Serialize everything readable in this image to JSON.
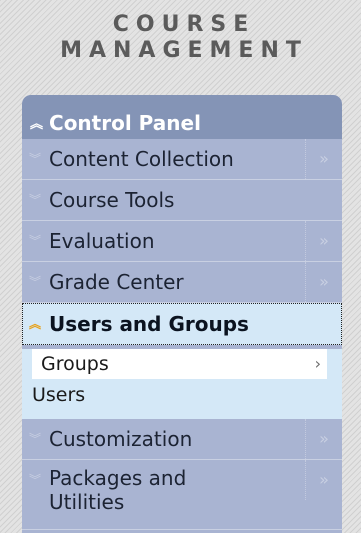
{
  "header": {
    "line1": "COURSE",
    "line2": "MANAGEMENT"
  },
  "panel": {
    "title": "Control Panel",
    "items": [
      {
        "label": "Content Collection",
        "has_more": true,
        "more": "»"
      },
      {
        "label": "Course Tools",
        "has_more": false,
        "more": ""
      },
      {
        "label": "Evaluation",
        "has_more": true,
        "more": "»"
      },
      {
        "label": "Grade Center",
        "has_more": true,
        "more": "»"
      }
    ],
    "active": {
      "label": "Users and Groups",
      "sub_items": [
        {
          "label": "Groups",
          "selected": true,
          "arrow": "›"
        },
        {
          "label": "Users",
          "selected": false
        }
      ]
    },
    "items_after": [
      {
        "label": "Customization",
        "more": "»"
      },
      {
        "label": "Packages and Utilities",
        "more": "»"
      }
    ]
  },
  "icons": {
    "collapse": "chevron-up-double-icon",
    "expand": "chevron-down-double-icon",
    "more": "double-angle-right-icon"
  },
  "colors": {
    "panel": "#a9b4d2",
    "title": "#8494b6",
    "active": "#d4e8f7",
    "accent": "#e7a21c"
  }
}
